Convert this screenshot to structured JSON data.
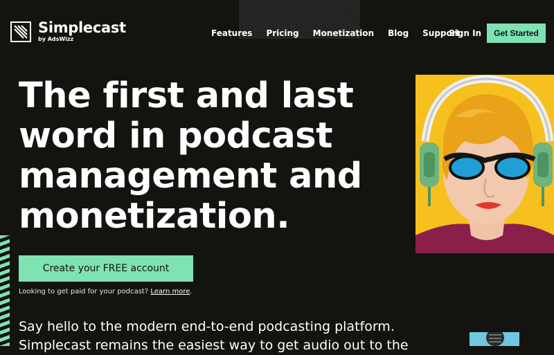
{
  "brand": {
    "name": "Simplecast",
    "sub": "by AdsWizz",
    "accent": "#7ee2b2",
    "bg": "#131310"
  },
  "nav": {
    "items": [
      "Features",
      "Pricing",
      "Monetization",
      "Blog",
      "Support"
    ],
    "sign_in": "Sign In",
    "get_started": "Get Started"
  },
  "hero": {
    "headline": "The first and last word in podcast management and monetization.",
    "cta": "Create your FREE account",
    "note_prefix": "Looking to get paid for your podcast?",
    "note_link": "Learn more",
    "note_suffix": ".",
    "intro": "Say hello to the modern end-to-end podcasting platform. Simplecast remains the easiest way to get audio out to the"
  },
  "icons": [
    "logo-mark-icon",
    "headphones-portrait-illustration",
    "microphone-illustration"
  ]
}
